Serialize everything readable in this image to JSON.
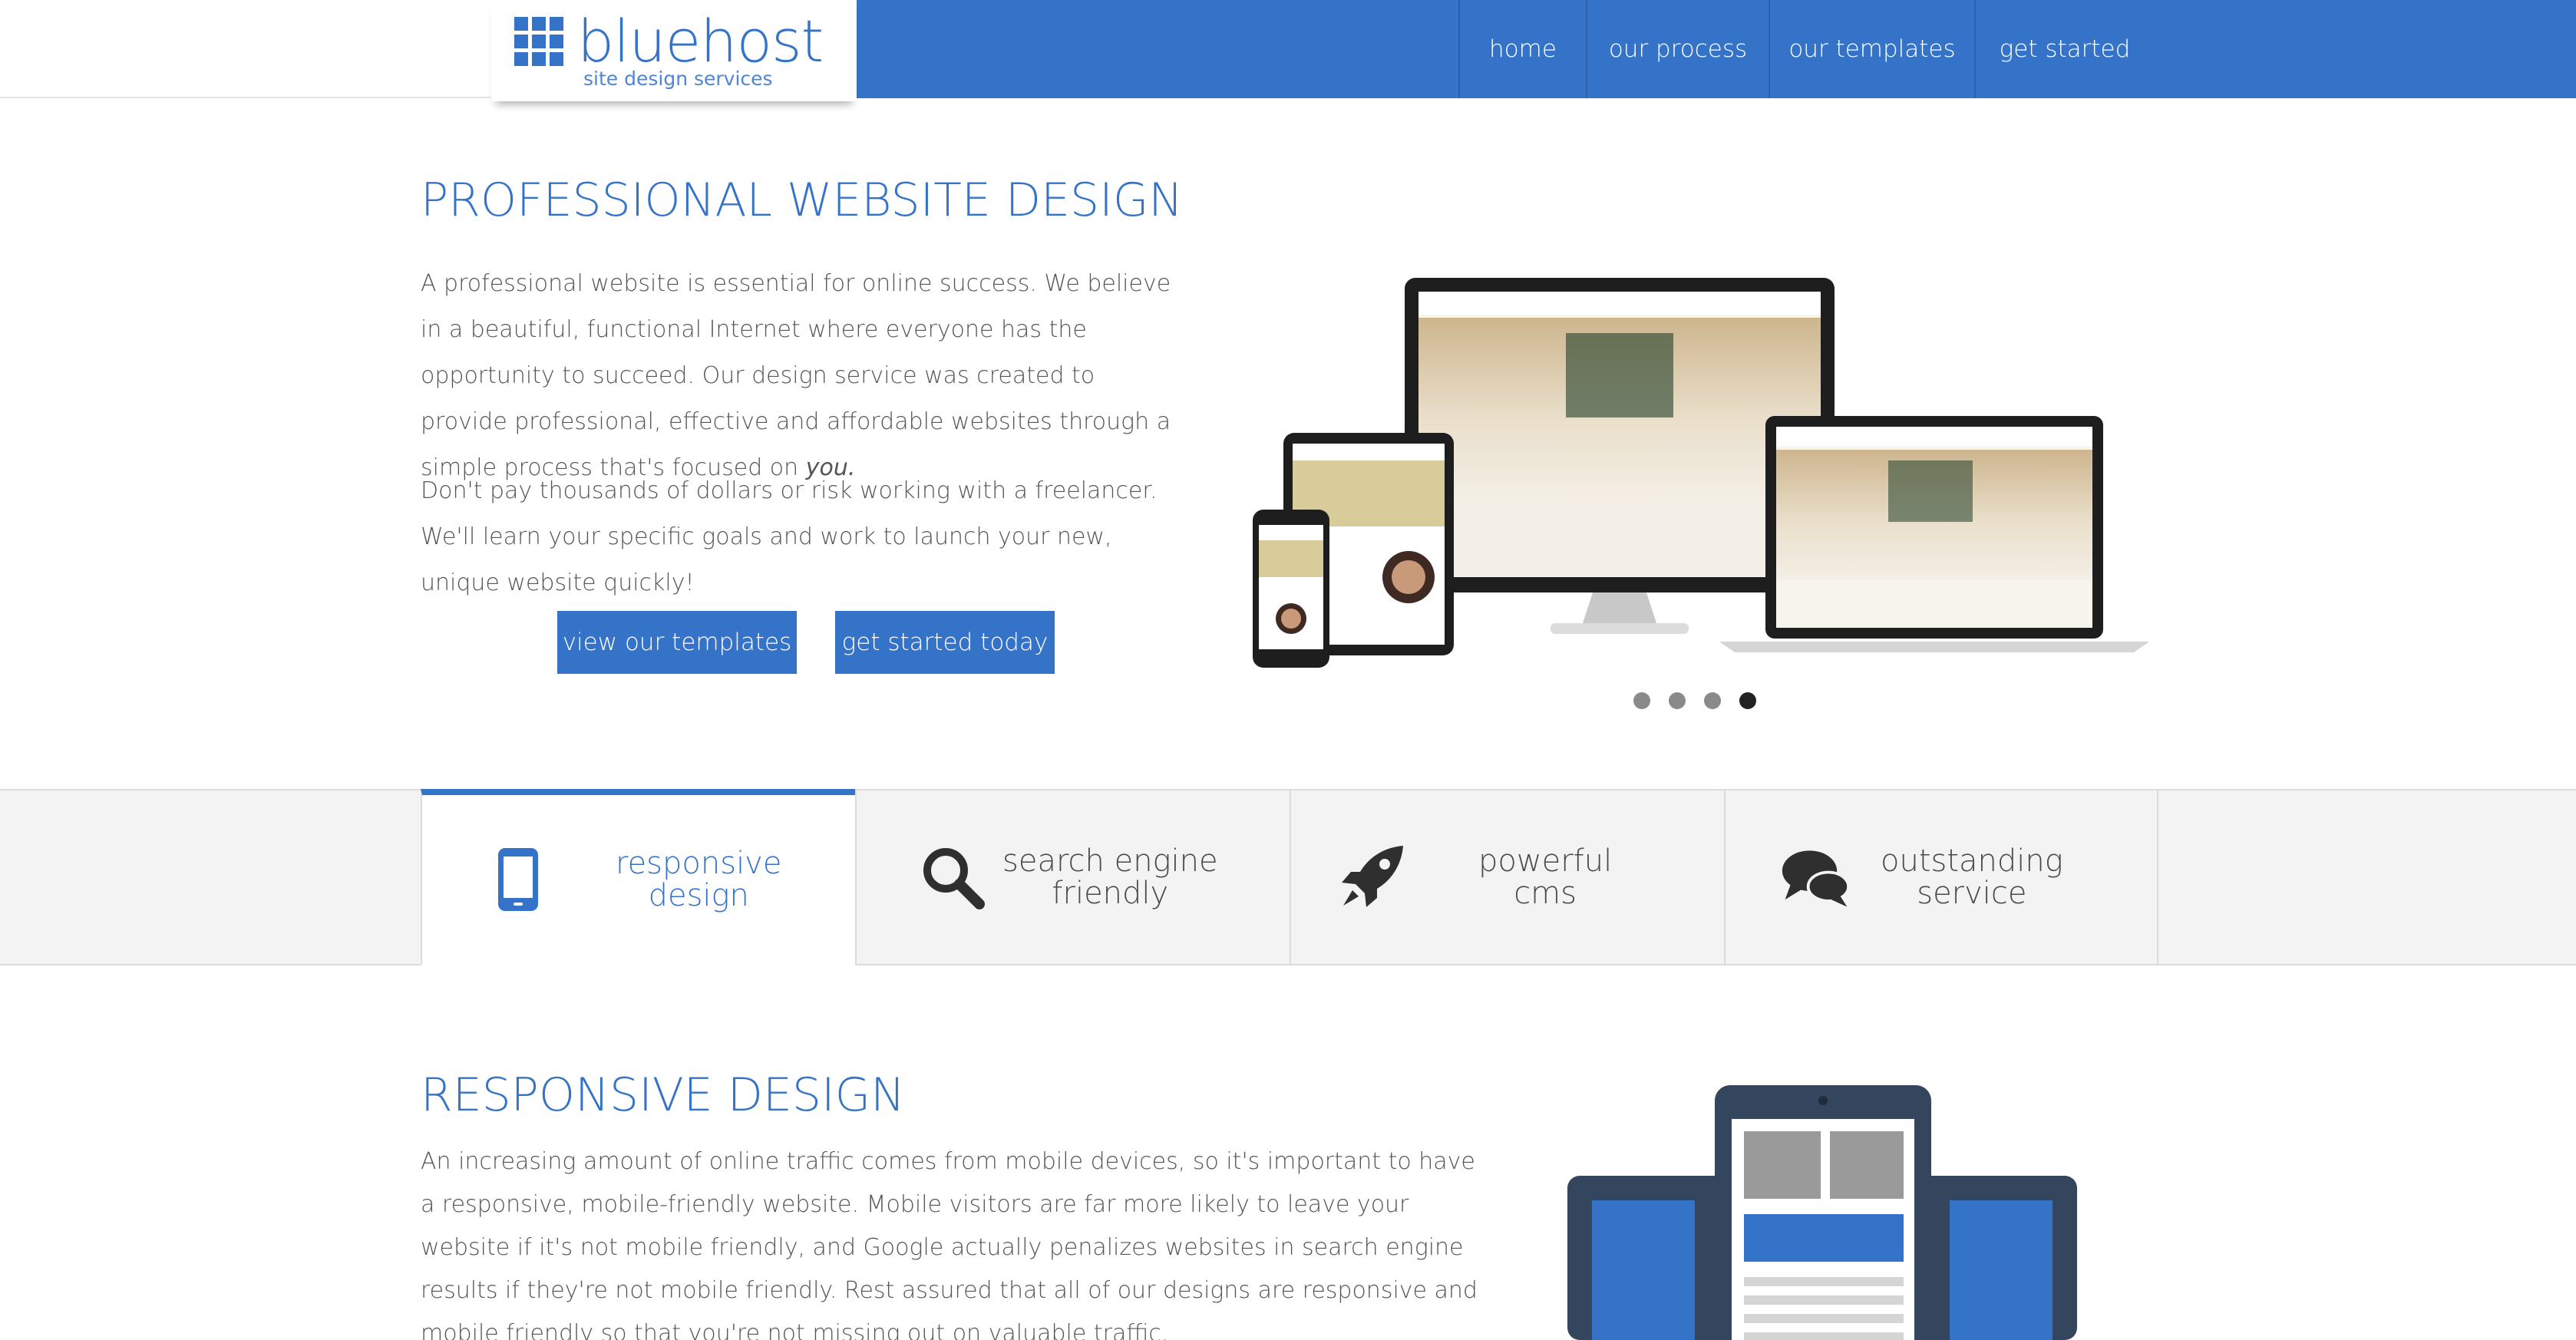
{
  "header": {
    "logo_text": "bluehost",
    "logo_subtitle": "site design services",
    "nav": [
      {
        "label": "home"
      },
      {
        "label": "our process"
      },
      {
        "label": "our templates"
      },
      {
        "label": "get started"
      }
    ]
  },
  "hero": {
    "title": "PROFESSIONAL WEBSITE DESIGN",
    "paragraph1": "A professional website is essential for online success. We believe in a beautiful, functional Internet where everyone has the opportunity to succeed. Our design service was created to provide professional, effective and affordable websites through a simple process that's focused on ",
    "paragraph1_emphasis": "you.",
    "paragraph2": "Don't pay thousands of dollars or risk working with a freelancer. We'll learn your specific goals and work to launch your new, unique website quickly!",
    "btn_templates": "view our templates",
    "btn_start": "get started today",
    "slider": {
      "count": 4,
      "active_index": 3
    }
  },
  "features": {
    "tabs": [
      {
        "label": "responsive design",
        "line1": "responsive",
        "line2": "design",
        "icon": "mobile-phone-icon",
        "active": true
      },
      {
        "label": "search engine friendly",
        "line1": "search engine",
        "line2": "friendly",
        "icon": "magnifier-icon",
        "active": false
      },
      {
        "label": "powerful cms",
        "line1": "powerful",
        "line2": "cms",
        "icon": "rocket-icon",
        "active": false
      },
      {
        "label": "outstanding service",
        "line1": "outstanding",
        "line2": "service",
        "icon": "chat-bubbles-icon",
        "active": false
      }
    ]
  },
  "responsive": {
    "title": "RESPONSIVE DESIGN",
    "paragraph": "An increasing amount of online traffic comes from mobile devices, so it's important to have a responsive, mobile-friendly website. Mobile visitors are far more likely to leave your website if it's not mobile friendly, and Google actually penalizes websites in search engine results if they're not mobile friendly. Rest assured that all of our designs are responsive and mobile friendly so that you're not missing out on valuable traffic."
  },
  "colors": {
    "brand_blue": "#3573c9",
    "dark_slate": "#34465e"
  }
}
